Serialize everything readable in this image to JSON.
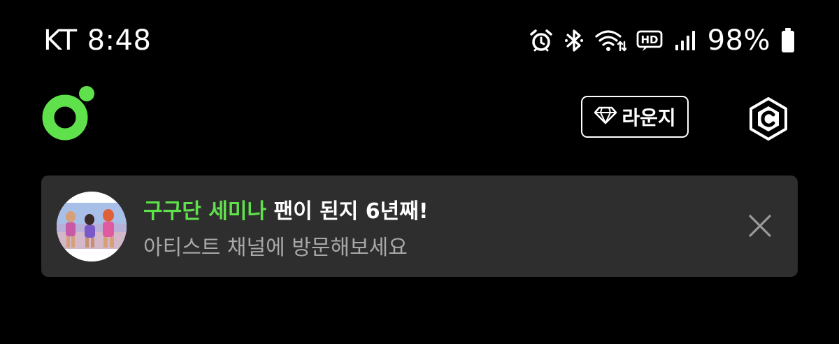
{
  "status_bar": {
    "carrier": "KT",
    "time": "8:48",
    "battery_percent": "98%",
    "icons": [
      "alarm-icon",
      "bluetooth-icon",
      "wifi-icon",
      "hd-voice-icon",
      "signal-icon",
      "battery-icon"
    ],
    "hd_label": "HD"
  },
  "header": {
    "logo_icon": "app-logo-icon",
    "lounge_label": "라운지",
    "lounge_icon": "diamond-icon",
    "coin_icon": "coin-c-icon"
  },
  "banner": {
    "artist_name": "구구단 세미나",
    "title_rest": " 팬이 된지 6년째!",
    "subtitle": "아티스트 채널에 방문해보세요",
    "close_icon": "close-icon"
  },
  "colors": {
    "background": "#000000",
    "accent_green": "#5fe14b",
    "banner_bg": "#2e2e2e",
    "subtitle_gray": "#a8a8a8"
  }
}
